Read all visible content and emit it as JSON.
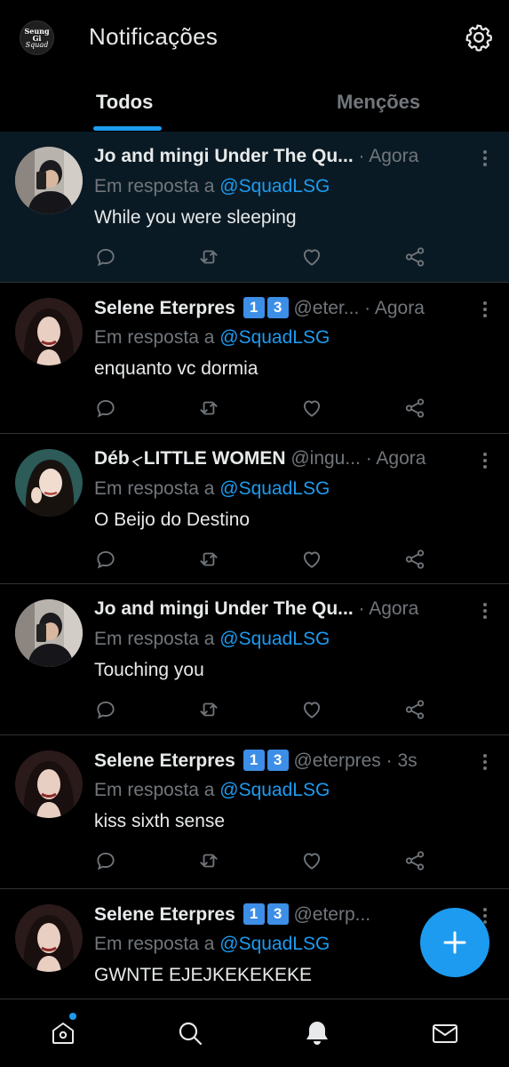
{
  "header": {
    "title": "Notificações",
    "avatar_text_1": "Seung Gi",
    "avatar_text_2": "Squad"
  },
  "tabs": [
    {
      "label": "Todos",
      "active": true
    },
    {
      "label": "Menções",
      "active": false
    }
  ],
  "colors": {
    "accent": "#1d9bf0",
    "background": "#000000",
    "muted": "#71767b"
  },
  "notifications": [
    {
      "name": "Jo and mingi Under The Qu...",
      "badges": [],
      "handle": "",
      "dot": "·",
      "time": "Agora",
      "reply_prefix": "Em resposta a",
      "mention": "@SquadLSG",
      "text": "While you were sleeping",
      "avatar": "avatar-man-mirror-selfie",
      "highlighted": true
    },
    {
      "name": "Selene Eterpres",
      "badges": [
        "1",
        "3"
      ],
      "handle": "@eter...",
      "dot": "·",
      "time": "Agora",
      "reply_prefix": "Em resposta a",
      "mention": "@SquadLSG",
      "text": "enquanto vc dormia",
      "avatar": "avatar-woman-dark-hair",
      "highlighted": false
    },
    {
      "name": "Déb",
      "name2": "LITTLE WOMEN",
      "badges": [],
      "handle": "@ingu...",
      "dot": "·",
      "time": "Agora",
      "reply_prefix": "Em resposta a",
      "mention": "@SquadLSG",
      "text": "O Beijo do Destino",
      "avatar": "avatar-woman-teal-background",
      "highlighted": false
    },
    {
      "name": "Jo and mingi Under The Qu...",
      "badges": [],
      "handle": "",
      "dot": "·",
      "time": "Agora",
      "reply_prefix": "Em resposta a",
      "mention": "@SquadLSG",
      "text": "Touching you",
      "avatar": "avatar-man-mirror-selfie",
      "highlighted": false
    },
    {
      "name": "Selene Eterpres",
      "badges": [
        "1",
        "3"
      ],
      "handle": "@eterpres",
      "dot": "·",
      "time": "3s",
      "reply_prefix": "Em resposta a",
      "mention": "@SquadLSG",
      "text": "kiss sixth sense",
      "avatar": "avatar-woman-dark-hair",
      "highlighted": false
    },
    {
      "name": "Selene Eterpres",
      "badges": [
        "1",
        "3"
      ],
      "handle": "@eterp...",
      "dot": "",
      "time": "",
      "reply_prefix": "Em resposta a",
      "mention": "@SquadLSG",
      "text": "GWNTE EJEJKEKEKEKE",
      "avatar": "avatar-woman-dark-hair",
      "highlighted": false
    }
  ],
  "fab": {
    "icon": "plus-icon"
  },
  "bottom_nav": [
    {
      "icon": "home-icon",
      "has_notification_dot": true
    },
    {
      "icon": "search-icon"
    },
    {
      "icon": "bell-icon",
      "active": true
    },
    {
      "icon": "mail-icon"
    }
  ]
}
